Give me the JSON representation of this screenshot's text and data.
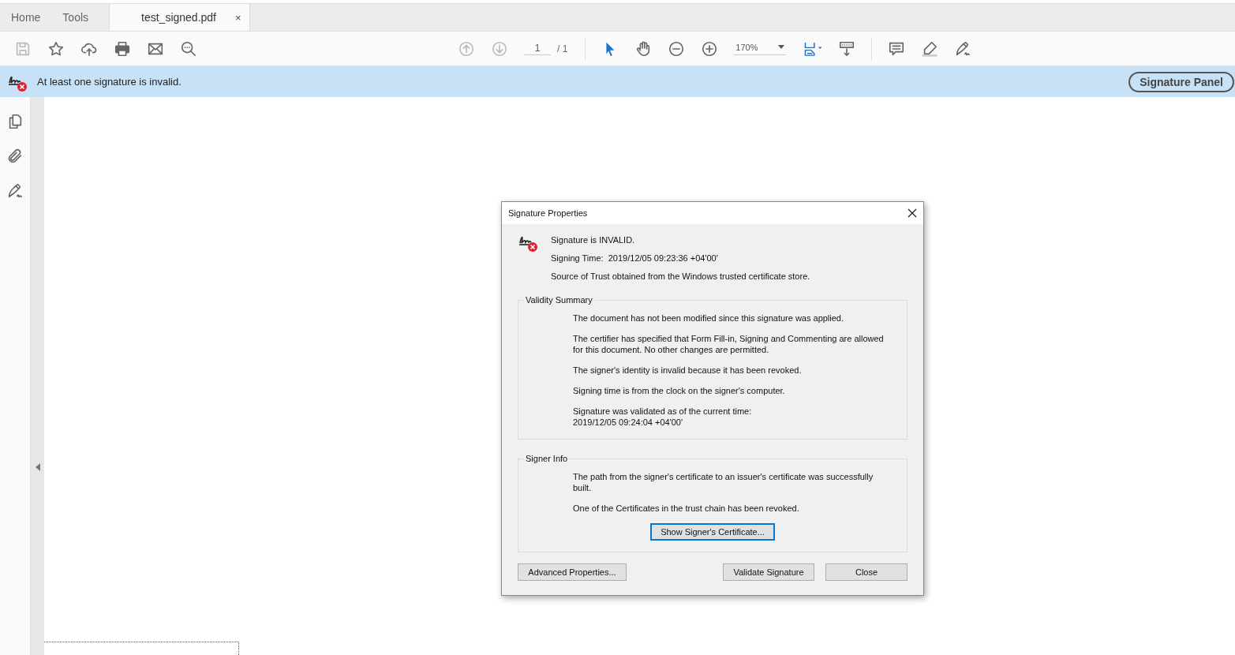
{
  "tabs": [
    {
      "label": "Home",
      "selected": false
    },
    {
      "label": "Tools",
      "selected": false
    },
    {
      "label": "test_signed.pdf",
      "selected": true,
      "close": "×"
    }
  ],
  "toolbar": {
    "left_tools": [
      {
        "kind": "save",
        "disabled": true
      },
      {
        "kind": "star",
        "disabled": false
      },
      {
        "kind": "upload",
        "disabled": false
      },
      {
        "kind": "print",
        "disabled": false
      },
      {
        "kind": "mail",
        "disabled": false
      },
      {
        "kind": "search",
        "disabled": false
      }
    ],
    "nav_tools": [
      {
        "kind": "up",
        "disabled": true
      },
      {
        "kind": "down",
        "disabled": true
      }
    ],
    "page_value": "1",
    "page_total": "/ 1",
    "view_tools": [
      {
        "kind": "pointer",
        "selected": true
      },
      {
        "kind": "hand",
        "selected": false
      },
      {
        "kind": "zoom-out",
        "selected": false
      },
      {
        "kind": "zoom-in",
        "selected": false
      }
    ],
    "zoom_value": "170%",
    "right_tools": [
      {
        "kind": "fit"
      },
      {
        "kind": "scroll"
      },
      {
        "kind": "comment"
      },
      {
        "kind": "highlight"
      },
      {
        "kind": "sign"
      }
    ]
  },
  "banner": {
    "message": "At least one signature is invalid.",
    "button": "Signature Panel"
  },
  "side_tools": [
    {
      "kind": "pages"
    },
    {
      "kind": "attachment"
    },
    {
      "kind": "sign"
    }
  ],
  "dialog": {
    "title": "Signature Properties",
    "status": "Signature is INVALID.",
    "signing_time": "Signing Time:  2019/12/05 09:23:36 +04'00'",
    "trust": "Source of Trust obtained from the Windows trusted certificate store.",
    "groups": [
      {
        "title": "Validity Summary",
        "paragraphs": [
          "The document has not been modified since this signature was applied.",
          "The certifier has specified that Form Fill-in, Signing and Commenting are allowed for this document. No other changes are permitted.",
          "The signer's identity is invalid because it has been revoked.",
          "Signing time is from the clock on the signer's computer.",
          "Signature was validated as of the current time:\n2019/12/05 09:24:04 +04'00'"
        ]
      },
      {
        "title": "Signer Info",
        "paragraphs": [
          "The path from the signer's certificate to an issuer's certificate was successfully built.",
          "One of the Certificates in the trust chain has been revoked."
        ],
        "button": {
          "label": "Show Signer's Certificate...",
          "focused": true
        }
      }
    ],
    "left_buttons": [
      "Advanced Properties..."
    ],
    "right_buttons": [
      "Validate Signature",
      "Close"
    ]
  }
}
